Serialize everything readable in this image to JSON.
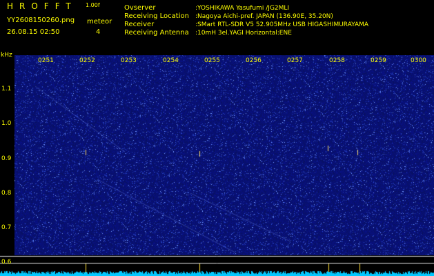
{
  "header": {
    "brand": "HROFFT",
    "version": "1.00f",
    "filename": "YY2608150260.png",
    "meteor_label": "meteor",
    "datetime": "26.08.15 02:50",
    "meteor_count": "4"
  },
  "info": {
    "observer_label": "Ovserver",
    "observer_value": ":YOSHIKAWA Yasufumi /JG2MLI",
    "location_label": "Receiving Location",
    "location_value": ":Nagoya Aichi-pref. JAPAN (136.90E, 35.20N)",
    "receiver_label": "Receiver",
    "receiver_value": ":SMart RTL-SDR V5 52.905MHz USB HIGASHIMURAYAMA",
    "antenna_label": "Receiving Antenna",
    "antenna_value": ":10mH 3el.YAGI Horizontal:ENE"
  },
  "spectrogram": {
    "y_unit": "kHz",
    "y_ticks": [
      "1.1",
      "1.0",
      "0.9",
      "0.8",
      "0.7",
      "0.6"
    ],
    "x_ticks": [
      "0251",
      "0252",
      "0253",
      "0254",
      "0255",
      "0256",
      "0257",
      "0258",
      "0259",
      "0300"
    ]
  },
  "colors": {
    "label": "#ffff00",
    "background": "#000000",
    "noise": "#0a1470",
    "trace": "#00c8ff"
  }
}
